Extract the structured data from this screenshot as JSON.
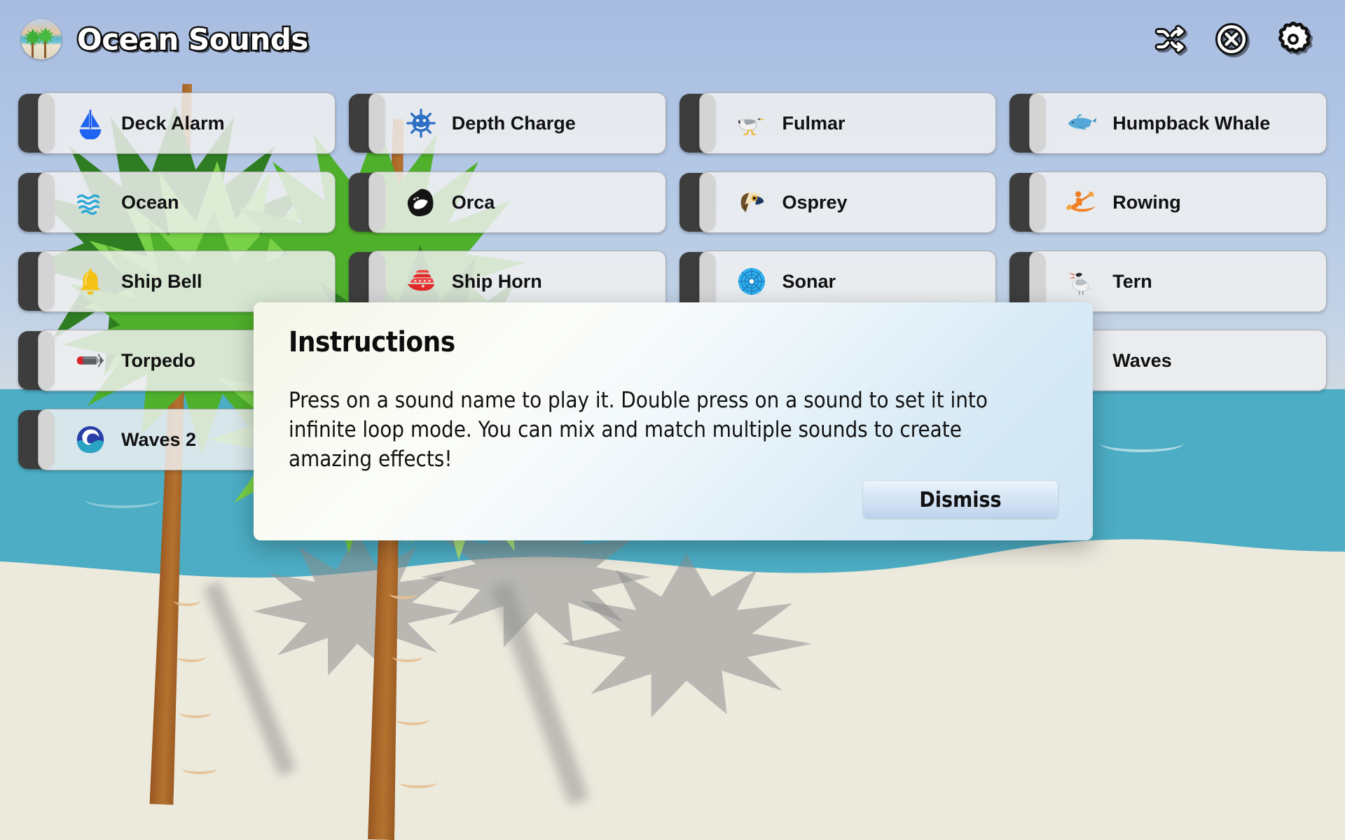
{
  "app": {
    "title": "Ocean Sounds",
    "logo_icon": "beach-palm-logo-icon"
  },
  "header": {
    "actions": [
      {
        "name": "shuffle-button",
        "icon": "shuffle-icon",
        "label": "Shuffle"
      },
      {
        "name": "stop-all-button",
        "icon": "stop-circle-icon",
        "label": "Stop All"
      },
      {
        "name": "settings-button",
        "icon": "gear-icon",
        "label": "Settings"
      }
    ]
  },
  "sounds": [
    {
      "label": "Deck Alarm",
      "icon": "sailboat-icon"
    },
    {
      "label": "Depth Charge",
      "icon": "naval-mine-icon"
    },
    {
      "label": "Fulmar",
      "icon": "seagull-icon"
    },
    {
      "label": "Humpback Whale",
      "icon": "whale-icon"
    },
    {
      "label": "Ocean",
      "icon": "water-wave-icon"
    },
    {
      "label": "Orca",
      "icon": "orca-icon"
    },
    {
      "label": "Osprey",
      "icon": "raptor-head-icon"
    },
    {
      "label": "Rowing",
      "icon": "kayak-icon"
    },
    {
      "label": "Ship Bell",
      "icon": "bell-icon"
    },
    {
      "label": "Ship Horn",
      "icon": "cruise-ship-icon"
    },
    {
      "label": "Sonar",
      "icon": "sonar-radar-icon"
    },
    {
      "label": "Tern",
      "icon": "tern-bird-icon"
    },
    {
      "label": "Torpedo",
      "icon": "torpedo-icon"
    },
    {
      "label": "",
      "icon": ""
    },
    {
      "label": "",
      "icon": ""
    },
    {
      "label": "Waves",
      "icon": ""
    },
    {
      "label": "Waves 2",
      "icon": "ocean-wave-icon"
    }
  ],
  "dialog": {
    "title": "Instructions",
    "body": "Press on a sound name to play it. Double press on a sound to set it into infinite loop mode. You can mix and match multiple sounds to create amazing effects!",
    "dismiss_label": "Dismiss"
  },
  "colors": {
    "ocean": "#4cadc4",
    "sand": "#ece9dd",
    "sky_top": "#a8bce0",
    "tab_dark": "#3d3d3d",
    "button_body": "#f1f1f1"
  }
}
